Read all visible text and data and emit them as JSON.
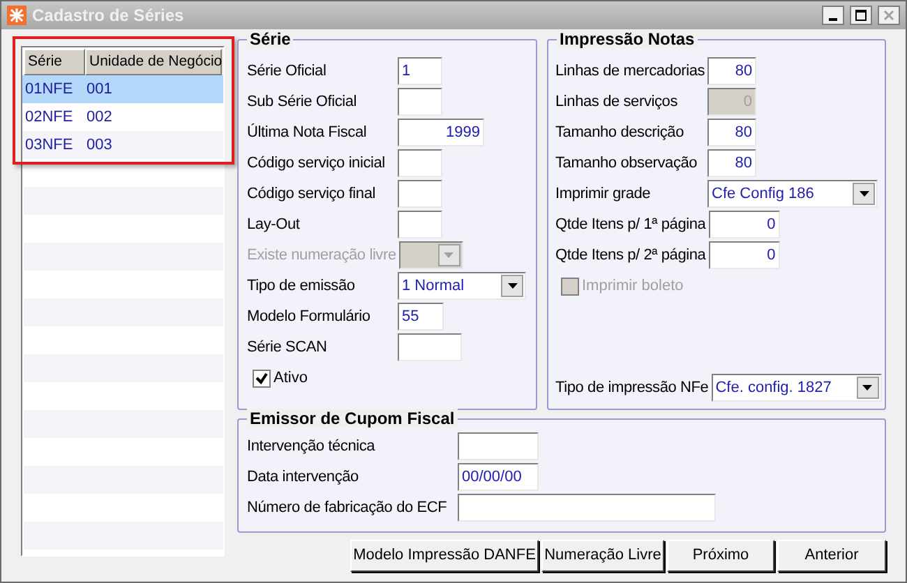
{
  "window": {
    "title": "Cadastro de Séries",
    "close_disabled": true
  },
  "series_list": {
    "columns": [
      "Série",
      "Unidade de Negócio"
    ],
    "highlighted": true,
    "rows": [
      {
        "cells": [
          "01NFE",
          "001"
        ],
        "selected": true
      },
      {
        "cells": [
          "02NFE",
          "002"
        ],
        "selected": false
      },
      {
        "cells": [
          "03NFE",
          "003"
        ],
        "selected": false
      }
    ]
  },
  "serie_group": {
    "title": "Série",
    "fields": [
      {
        "kind": "text",
        "label": "Série Oficial",
        "value": "1",
        "disabled": false
      },
      {
        "kind": "text",
        "label": "Sub Série Oficial",
        "disabled": false
      },
      {
        "kind": "number",
        "label": "Última Nota Fiscal",
        "value": "1999",
        "disabled": false
      },
      {
        "kind": "text",
        "label": "Código serviço inicial",
        "disabled": false
      },
      {
        "kind": "text",
        "label": "Código serviço final",
        "disabled": false
      },
      {
        "kind": "text",
        "label": "Lay-Out",
        "disabled": false
      },
      {
        "kind": "select",
        "label": "Existe numeração livre",
        "disabled": true
      },
      {
        "kind": "select",
        "label": "Tipo de emissão",
        "value": "1 Normal",
        "disabled": false
      },
      {
        "kind": "text",
        "label": "Modelo Formulário",
        "value": "55",
        "disabled": false
      },
      {
        "kind": "text",
        "label": "Série SCAN",
        "disabled": false
      },
      {
        "kind": "checkbox",
        "label": "Ativo",
        "checked": true,
        "disabled": false
      }
    ]
  },
  "impressao_group": {
    "title": "Impressão Notas",
    "fields": [
      {
        "kind": "number",
        "label": "Linhas de mercadorias",
        "value": "80",
        "disabled": false
      },
      {
        "kind": "number",
        "label": "Linhas de serviços",
        "value": "0",
        "disabled": true
      },
      {
        "kind": "number",
        "label": "Tamanho descrição",
        "value": "80",
        "disabled": false
      },
      {
        "kind": "number",
        "label": "Tamanho observação",
        "value": "80",
        "disabled": false
      },
      {
        "kind": "select",
        "label": "Imprimir grade",
        "value": "Cfe Config 186",
        "disabled": false
      },
      {
        "kind": "number",
        "label": "Qtde Itens p/ 1ª página",
        "value": "0",
        "disabled": false
      },
      {
        "kind": "number",
        "label": "Qtde Itens p/ 2ª página",
        "value": "0",
        "disabled": false
      },
      {
        "kind": "checkbox",
        "label": "Imprimir boleto",
        "checked": false,
        "disabled": true
      }
    ],
    "bottom_field": {
      "kind": "select",
      "label": "Tipo de impressão NFe",
      "value": "Cfe. config. 1827",
      "disabled": false
    }
  },
  "emissor_group": {
    "title": "Emissor de Cupom Fiscal",
    "fields": [
      {
        "kind": "text",
        "label": "Intervenção técnica",
        "disabled": false
      },
      {
        "kind": "text",
        "label": "Data intervenção",
        "value": "00/00/00",
        "disabled": false
      },
      {
        "kind": "text",
        "label": "Número de fabricação do ECF",
        "disabled": false
      }
    ]
  },
  "buttons": [
    "Modelo Impressão DANFE",
    "Numeração Livre",
    "Próximo",
    "Anterior"
  ]
}
